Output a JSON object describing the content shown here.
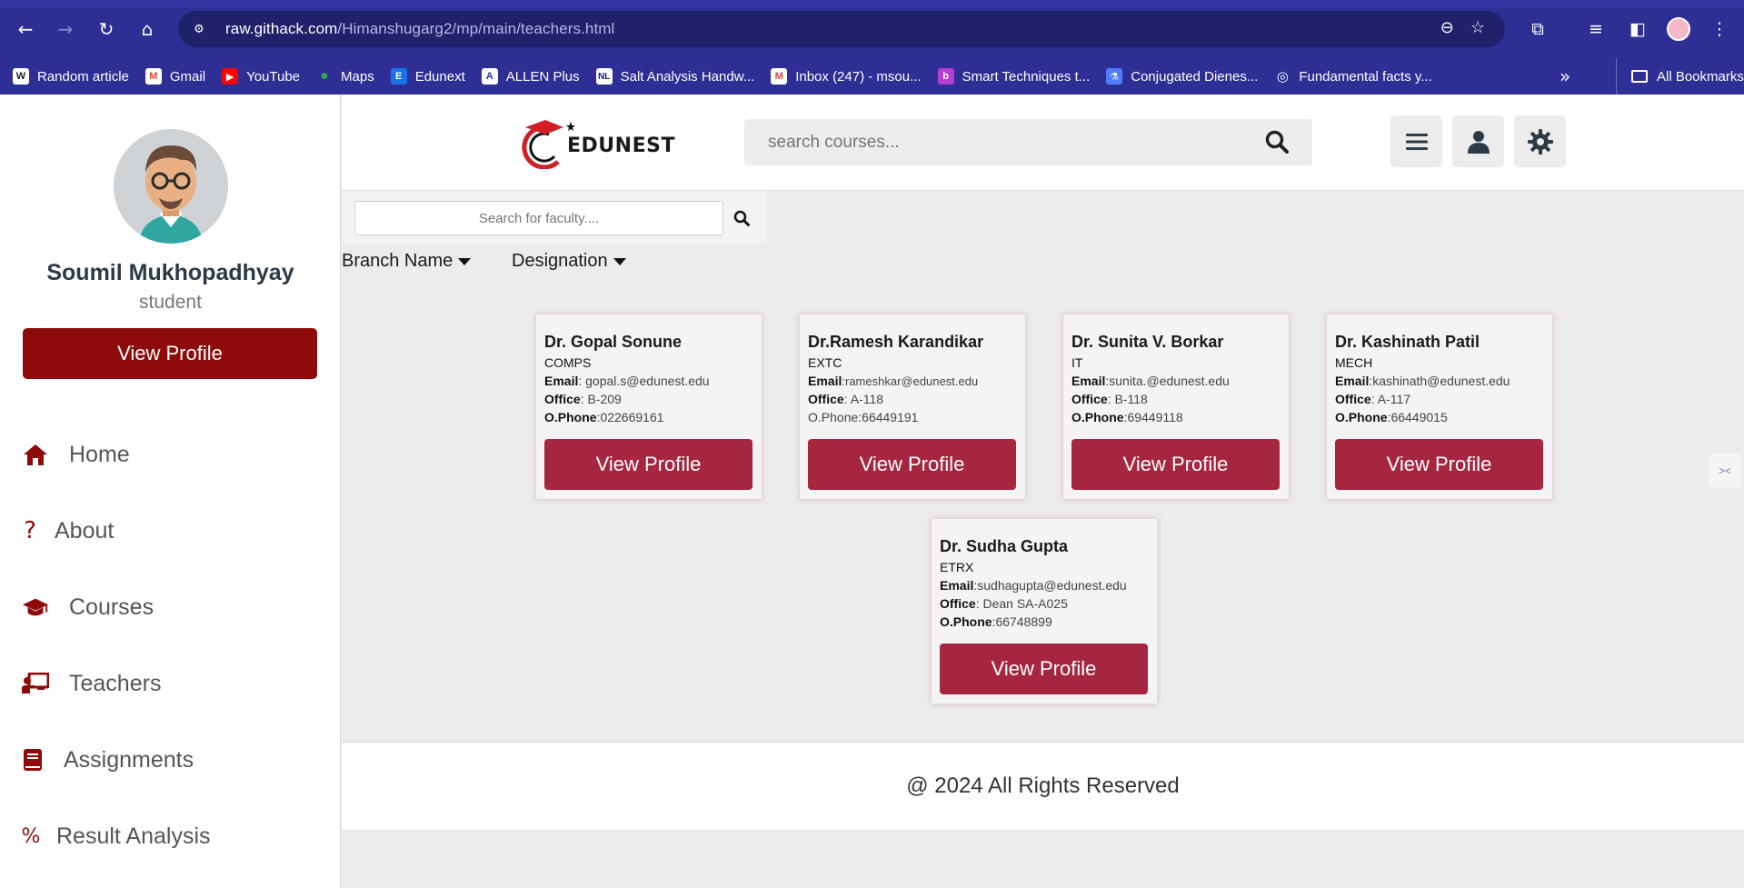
{
  "browser": {
    "url_host": "raw.githack.com",
    "url_path": "/Himanshugarg2/mp/main/teachers.html",
    "bookmarks": [
      {
        "label": "Random article",
        "icon": "wikipedia-icon",
        "color": "#ffffff"
      },
      {
        "label": "Gmail",
        "icon": "gmail-icon",
        "color": "#ea4335"
      },
      {
        "label": "YouTube",
        "icon": "youtube-icon",
        "color": "#ff0000"
      },
      {
        "label": "Maps",
        "icon": "maps-icon",
        "color": "#34a853"
      },
      {
        "label": "Edunext",
        "icon": "edunext-icon",
        "color": "#1a73e8"
      },
      {
        "label": "ALLEN Plus",
        "icon": "allen-icon",
        "color": "#ffffff"
      },
      {
        "label": "Salt Analysis Handw...",
        "icon": "nl-icon",
        "color": "#ffffff"
      },
      {
        "label": "Inbox (247) - msou...",
        "icon": "gmail-icon",
        "color": "#ea4335"
      },
      {
        "label": "Smart Techniques t...",
        "icon": "doc-icon",
        "color": "#b33fd1"
      },
      {
        "label": "Conjugated Dienes...",
        "icon": "flask-icon",
        "color": "#4f7cff"
      },
      {
        "label": "Fundamental facts y...",
        "icon": "globe-icon",
        "color": "#ffffff"
      }
    ],
    "all_bookmarks": "All Bookmarks"
  },
  "sidebar": {
    "user_name": "Soumil Mukhopadhyay",
    "user_role": "student",
    "profile_button": "View Profile",
    "menu": [
      {
        "label": "Home",
        "icon": "home-icon"
      },
      {
        "label": "About",
        "icon": "question-icon"
      },
      {
        "label": "Courses",
        "icon": "graduation-cap-icon"
      },
      {
        "label": "Teachers",
        "icon": "teacher-icon"
      },
      {
        "label": "Assignments",
        "icon": "book-icon"
      },
      {
        "label": "Result Analysis",
        "icon": "percent-icon"
      }
    ]
  },
  "header": {
    "logo_text": "EDUNEST",
    "search_placeholder": "search courses..."
  },
  "content": {
    "faculty_search_placeholder": "Search for faculty....",
    "filters": [
      "Branch Name",
      "Designation"
    ],
    "cards": [
      {
        "name": "Dr. Gopal Sonune",
        "branch": "COMPS",
        "email": "gopal.s@edunest.edu",
        "office": "B-209",
        "phone": "022669161",
        "button": "View Profile"
      },
      {
        "name": "Dr.Ramesh Karandikar",
        "branch": "EXTC",
        "email": "rameshkar@edunest.edu",
        "office": "A-118",
        "phone": "66449191",
        "button": "View Profile"
      },
      {
        "name": "Dr. Sunita V. Borkar",
        "branch": "IT",
        "email": "sunita.@edunest.edu",
        "office": "B-118",
        "phone": "69449118",
        "button": "View Profile"
      },
      {
        "name": "Dr. Kashinath Patil",
        "branch": "MECH",
        "email": "kashinath@edunest.edu",
        "office": "A-117",
        "phone": "66449015",
        "button": "View Profile"
      },
      {
        "name": "Dr. Sudha Gupta",
        "branch": "ETRX",
        "email": "sudhagupta@edunest.edu",
        "office": "Dean SA-A025",
        "phone": "66748899",
        "button": "View Profile"
      }
    ],
    "labels": {
      "email": "Email",
      "office": "Office",
      "phone": "O.Phone"
    }
  },
  "footer": {
    "text": "@ 2024 All Rights Reserved"
  },
  "colors": {
    "sidebar_button": "#8e0b0b",
    "card_button": "#a7263f",
    "chrome": "#2e2e95"
  }
}
